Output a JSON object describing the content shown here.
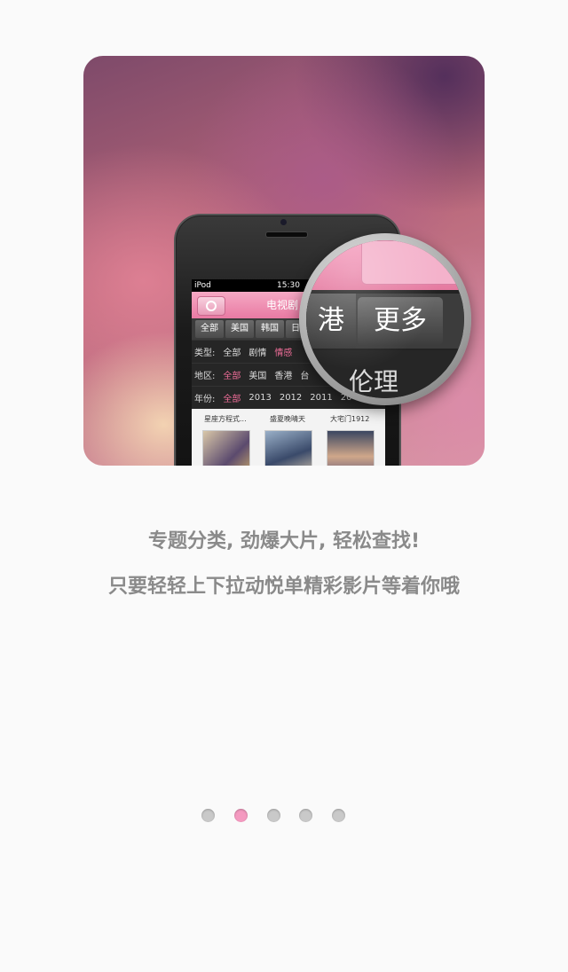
{
  "phone_screen": {
    "carrier": "iPod",
    "time": "15:30",
    "nav_title": "电视剧",
    "categories": [
      "全部",
      "美国",
      "韩国",
      "日"
    ],
    "filters": {
      "type": {
        "label": "类型:",
        "options": [
          "全部",
          "剧情",
          "情感"
        ],
        "selected": "情感"
      },
      "region": {
        "label": "地区:",
        "options": [
          "全部",
          "美国",
          "香港",
          "台"
        ],
        "selected": "全部"
      },
      "year": {
        "label": "年份:",
        "options": [
          "全部",
          "2013",
          "2012",
          "2011",
          "20"
        ],
        "selected": "全部"
      }
    },
    "thumbnails": [
      "星座方程式...",
      "盛夏晚晴天",
      "大宅门1912"
    ]
  },
  "magnifier": {
    "left_tab": "港",
    "more_button": "更多",
    "bottom_text": "伦理"
  },
  "captions": {
    "line1": "专题分类, 劲爆大片, 轻松查找!",
    "line2": "只要轻轻上下拉动悦单精彩影片等着你哦"
  },
  "pagination": {
    "total": 5,
    "active_index": 1,
    "active_color": "#f49ac0",
    "inactive_color": "#c9c9c9"
  }
}
